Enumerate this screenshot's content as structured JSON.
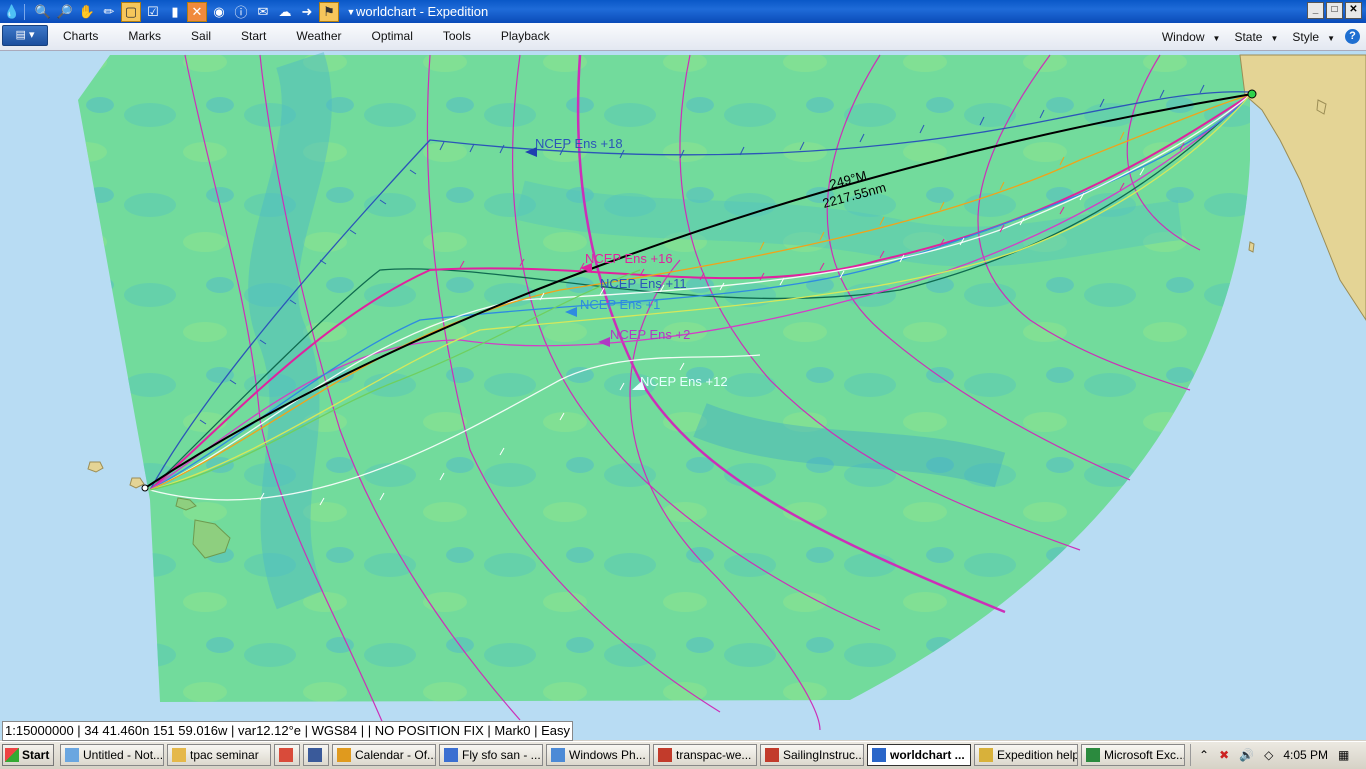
{
  "window": {
    "title": "worldchart - Expedition",
    "controls": [
      "_",
      "□",
      "✕"
    ]
  },
  "toolbar_icons": [
    "expedition-drop-icon",
    "zoom-in-icon",
    "zoom-out-icon",
    "pan-hand-icon",
    "pencil-icon",
    "page-icon",
    "check-icon",
    "folder-icon",
    "close-x-icon",
    "globe-icon",
    "info-icon",
    "mail-icon",
    "cloud-icon",
    "arrow-icon",
    "marks-icon"
  ],
  "menu": {
    "items": [
      "Charts",
      "Marks",
      "Sail",
      "Start",
      "Weather",
      "Optimal",
      "Tools",
      "Playback"
    ],
    "right": [
      "Window",
      "State",
      "Style"
    ],
    "help": "?"
  },
  "chart": {
    "route_labels": {
      "bearing": "249°M",
      "distance": "2217.55nm",
      "ens18": "NCEP Ens +18",
      "ens16": "NCEP Ens +16",
      "ens11": "NCEP Ens +11",
      "ens1": "NCEP Ens +1",
      "ens2": "NCEP Ens +2",
      "ens12": "NCEP Ens +12"
    },
    "colors": {
      "sea": "#b8dcf3",
      "land": "#e4d495",
      "wind_field": "#72db9c",
      "isobar": "#cc2fb8",
      "great_circle": "#000000",
      "ens18": "#2b55b8",
      "ens16": "#e0229f",
      "ens12": "#ffffff",
      "ens2": "#d23ec6"
    }
  },
  "status": "1:15000000 | 34 41.460n 151 59.016w | var12.12°e | WGS84 | | NO POSITION FIX | Mark0 | Easy",
  "taskbar": {
    "start": "Start",
    "tasks": [
      {
        "label": "Untitled - Not...",
        "icon": "notepad-icon",
        "width": 104
      },
      {
        "label": "tpac seminar",
        "icon": "folder-icon",
        "width": 104
      },
      {
        "label": "",
        "icon": "chrome-icon",
        "width": 26
      },
      {
        "label": "",
        "icon": "arrow-app-icon",
        "width": 26
      },
      {
        "label": "Calendar - Of...",
        "icon": "outlook-icon",
        "width": 104
      },
      {
        "label": "Fly sfo san - ...",
        "icon": "calendar-icon",
        "width": 104
      },
      {
        "label": "Windows Ph...",
        "icon": "photo-icon",
        "width": 104
      },
      {
        "label": "transpac-we...",
        "icon": "pdf-icon",
        "width": 104
      },
      {
        "label": "SailingInstruc...",
        "icon": "pdf-icon",
        "width": 104
      },
      {
        "label": "worldchart ...",
        "icon": "expedition-icon",
        "width": 104,
        "active": true
      },
      {
        "label": "Expedition help",
        "icon": "help-icon",
        "width": 104
      },
      {
        "label": "Microsoft Exc...",
        "icon": "excel-icon",
        "width": 104
      }
    ],
    "clock": "4:05 PM"
  }
}
